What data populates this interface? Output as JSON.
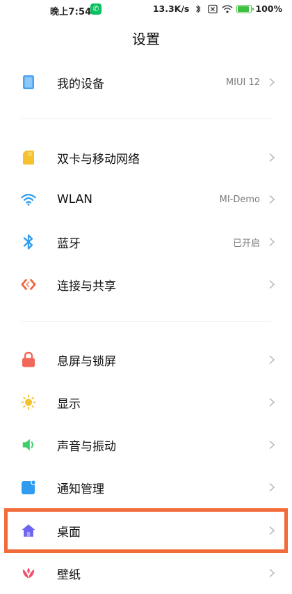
{
  "status_bar": {
    "time": "晚上7:54",
    "network_speed": "13.3K/s",
    "battery_percent": "100%"
  },
  "header": {
    "title": "设置"
  },
  "sections": [
    {
      "items": [
        {
          "label": "我的设备",
          "value": "MIUI 12",
          "icon": "device-icon",
          "color": "#4aa3f0"
        }
      ]
    },
    {
      "items": [
        {
          "label": "双卡与移动网络",
          "value": "",
          "icon": "sim-card-icon",
          "color": "#f5c12e"
        },
        {
          "label": "WLAN",
          "value": "MI-Demo",
          "icon": "wifi-icon",
          "color": "#2f9cf0"
        },
        {
          "label": "蓝牙",
          "value": "已开启",
          "icon": "bluetooth-icon",
          "color": "#2f9cf0"
        },
        {
          "label": "连接与共享",
          "value": "",
          "icon": "connection-share-icon",
          "color": "#f0643c"
        }
      ]
    },
    {
      "items": [
        {
          "label": "息屏与锁屏",
          "value": "",
          "icon": "lock-icon",
          "color": "#f2675a"
        },
        {
          "label": "显示",
          "value": "",
          "icon": "sun-icon",
          "color": "#f5c12e"
        },
        {
          "label": "声音与振动",
          "value": "",
          "icon": "speaker-icon",
          "color": "#3ccf6e"
        },
        {
          "label": "通知管理",
          "value": "",
          "icon": "notification-icon",
          "color": "#2f9cf0"
        },
        {
          "label": "桌面",
          "value": "",
          "icon": "home-icon",
          "color": "#6c63f0"
        },
        {
          "label": "壁纸",
          "value": "",
          "icon": "flower-icon",
          "color": "#f2506e"
        }
      ]
    }
  ]
}
